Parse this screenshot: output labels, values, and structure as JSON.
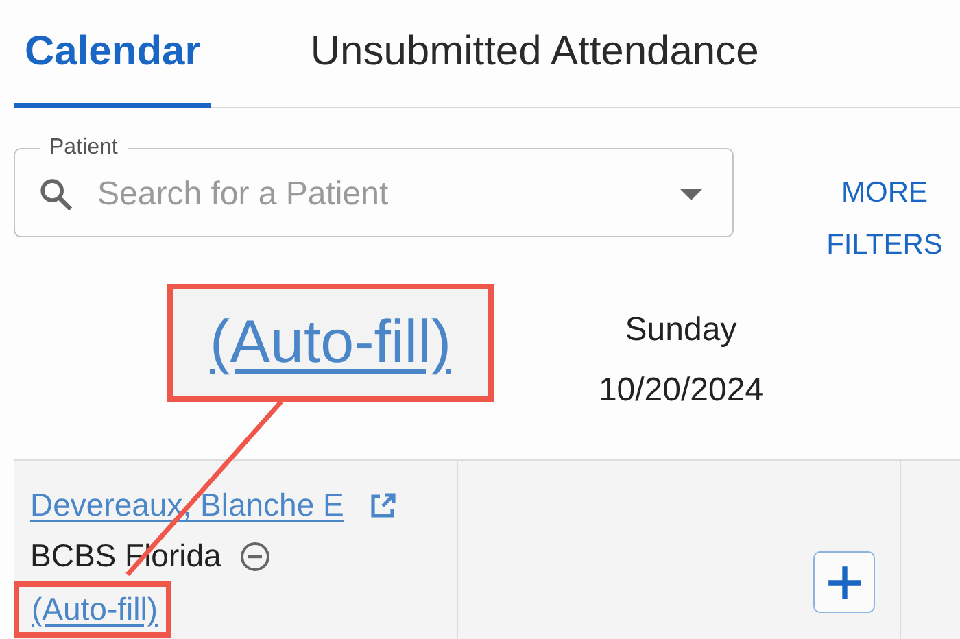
{
  "tabs": [
    {
      "label": "Calendar",
      "selected": true
    },
    {
      "label": "Unsubmitted Attendance",
      "selected": false
    }
  ],
  "patient_field": {
    "label": "Patient",
    "placeholder": "Search for a Patient"
  },
  "more_filters": "MORE FILTERS",
  "day_header": {
    "day": "Sunday",
    "date": "10/20/2024"
  },
  "rows": [
    {
      "patient": "Devereaux, Blanche E",
      "payer": "BCBS Florida",
      "autofill": "(Auto-fill)",
      "highlighted": true
    }
  ],
  "callout": {
    "text": "(Auto-fill)"
  }
}
